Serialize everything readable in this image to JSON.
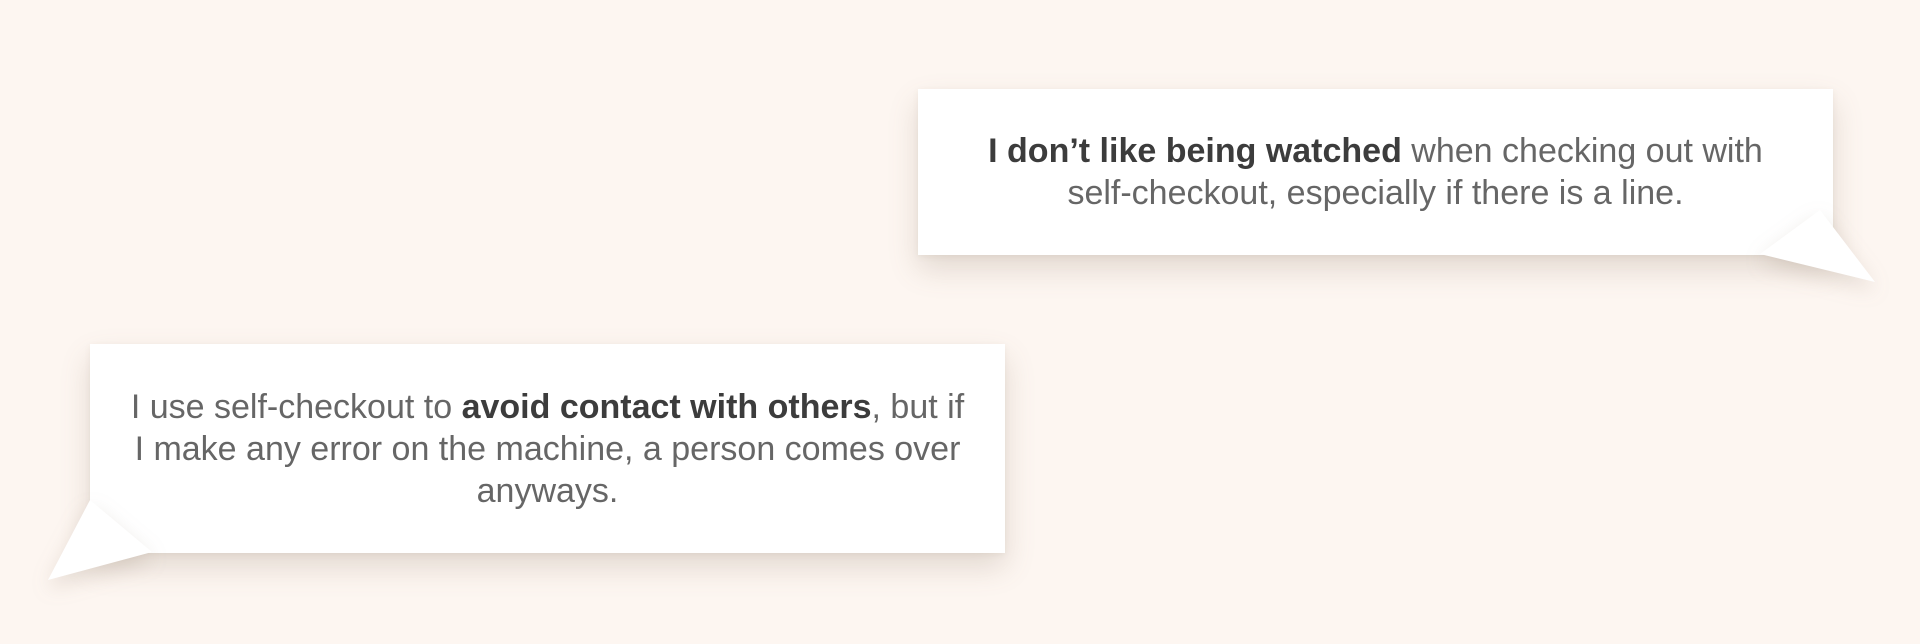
{
  "colors": {
    "background": "#fdf6f1",
    "bubble": "#ffffff",
    "text": "#666666",
    "emphasis": "#3c3c3c"
  },
  "quotes": [
    {
      "emphasis": "I don’t like being watched",
      "rest": " when checking out with self-checkout, especially if there is a line."
    },
    {
      "lead": "I use self-checkout to ",
      "emphasis": "avoid contact with others",
      "rest": ", but if I make any error on the machine, a person comes over anyways."
    }
  ]
}
